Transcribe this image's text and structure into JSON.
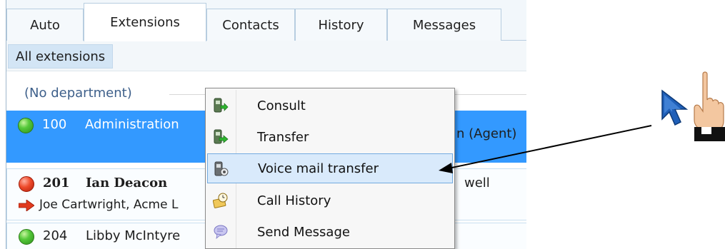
{
  "tabs": [
    {
      "label": "Auto"
    },
    {
      "label": "Extensions"
    },
    {
      "label": "Contacts"
    },
    {
      "label": "History"
    },
    {
      "label": "Messages"
    }
  ],
  "active_tab": "Extensions",
  "filter": {
    "label": "All extensions"
  },
  "department": {
    "label": "(No department)"
  },
  "rows": [
    {
      "ext": "100",
      "name": "Administration",
      "status_color": "green",
      "right_text": "n (Agent)",
      "selected": true
    },
    {
      "ext": "201",
      "name": "Ian Deacon",
      "status_color": "red",
      "right_text": "well",
      "subline": "Joe Cartwright, Acme L"
    },
    {
      "ext": "204",
      "name": "Libby McIntyre",
      "status_color": "green"
    }
  ],
  "context_menu": {
    "items": [
      {
        "label": "Consult",
        "icon": "phone-consult-icon"
      },
      {
        "label": "Transfer",
        "icon": "phone-transfer-icon"
      },
      {
        "label": "Voice mail transfer",
        "icon": "voicemail-transfer-icon",
        "highlighted": true
      },
      {
        "label": "Call History",
        "icon": "call-history-icon"
      },
      {
        "label": "Send Message",
        "icon": "send-message-icon"
      }
    ]
  },
  "colors": {
    "selection": "#3399ff",
    "menu_highlight": "#d9eafb",
    "cursor": "#1f5fb8"
  },
  "annotation": {
    "pointer": "mouse-cursor-icon",
    "hand": "pointing-hand-icon"
  }
}
